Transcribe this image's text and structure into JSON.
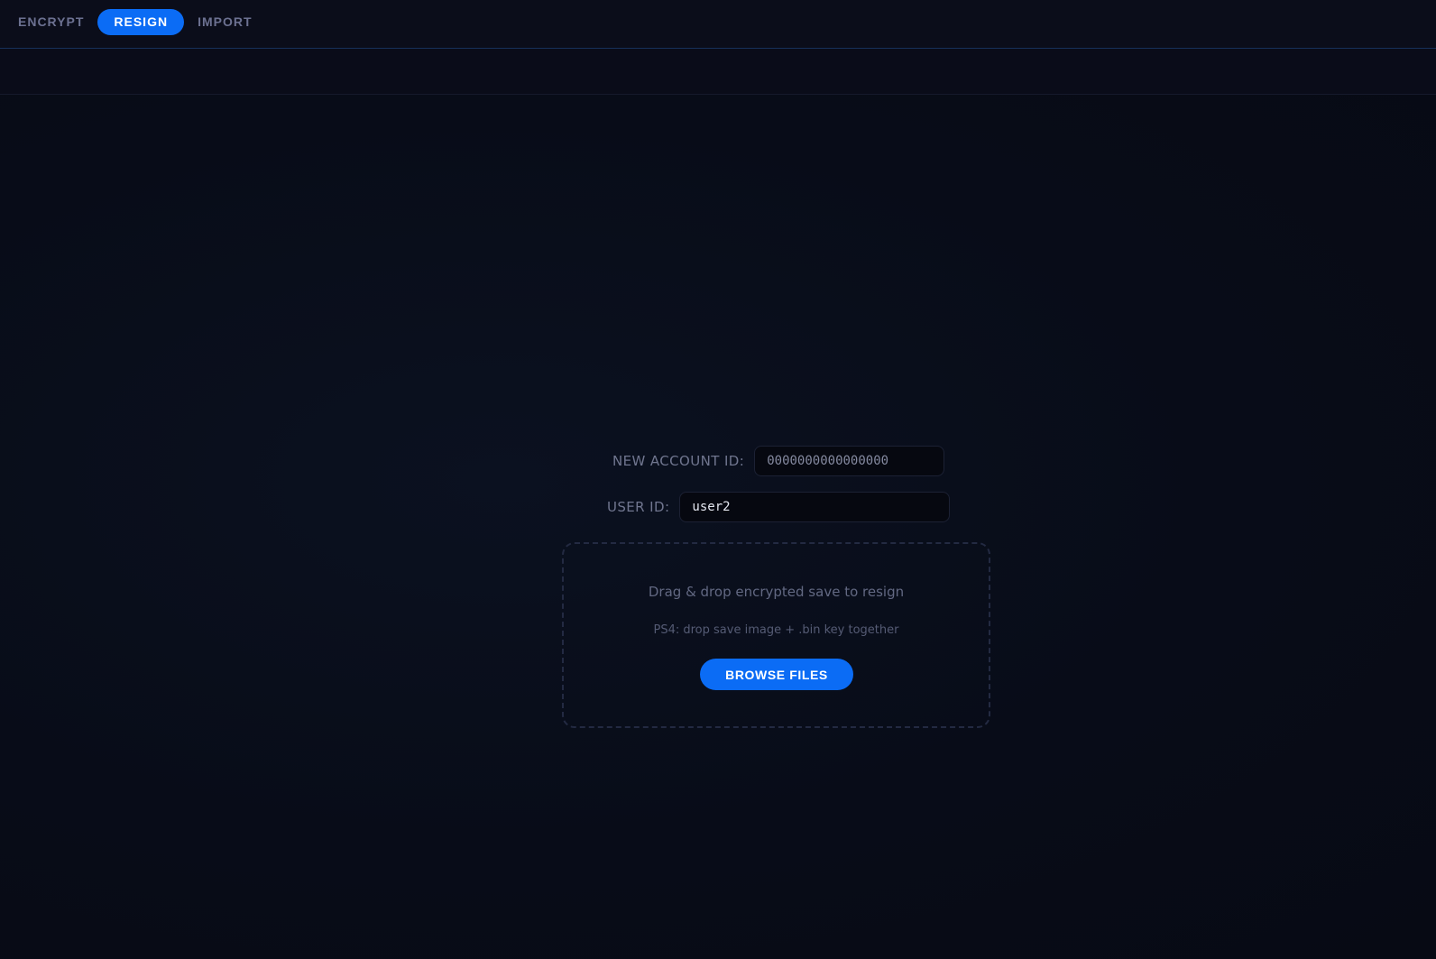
{
  "nav": {
    "tabs": [
      {
        "label": "ENCRYPT",
        "active": false
      },
      {
        "label": "RESIGN",
        "active": true
      },
      {
        "label": "IMPORT",
        "active": false
      }
    ]
  },
  "form": {
    "account_id": {
      "label": "NEW ACCOUNT ID:",
      "value": "",
      "placeholder": "0000000000000000"
    },
    "user_id": {
      "label": "USER ID:",
      "value": "user2",
      "placeholder": ""
    }
  },
  "dropzone": {
    "title": "Drag & drop encrypted save to resign",
    "subtitle": "PS4: drop save image + .bin key together",
    "button_label": "BROWSE FILES"
  },
  "colors": {
    "accent": "#0b6cf5",
    "background": "#080c18"
  }
}
